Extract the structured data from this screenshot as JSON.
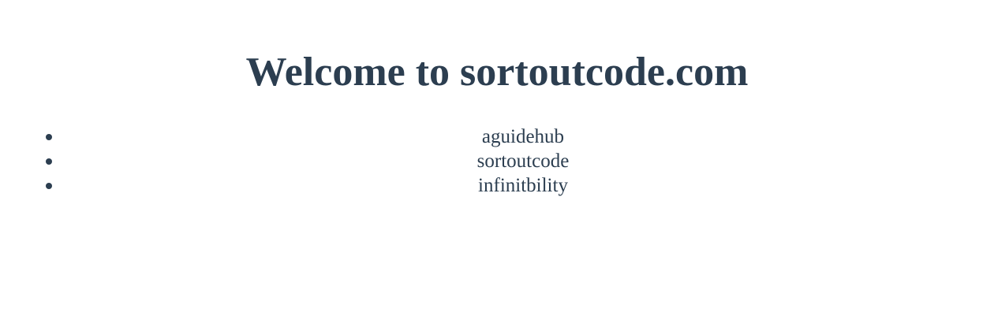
{
  "page": {
    "title": "Welcome to sortoutcode.com"
  },
  "list": {
    "items": [
      {
        "label": "aguidehub"
      },
      {
        "label": "sortoutcode"
      },
      {
        "label": "infinitbility"
      }
    ]
  },
  "colors": {
    "text": "#2c3e50",
    "background": "#ffffff"
  }
}
